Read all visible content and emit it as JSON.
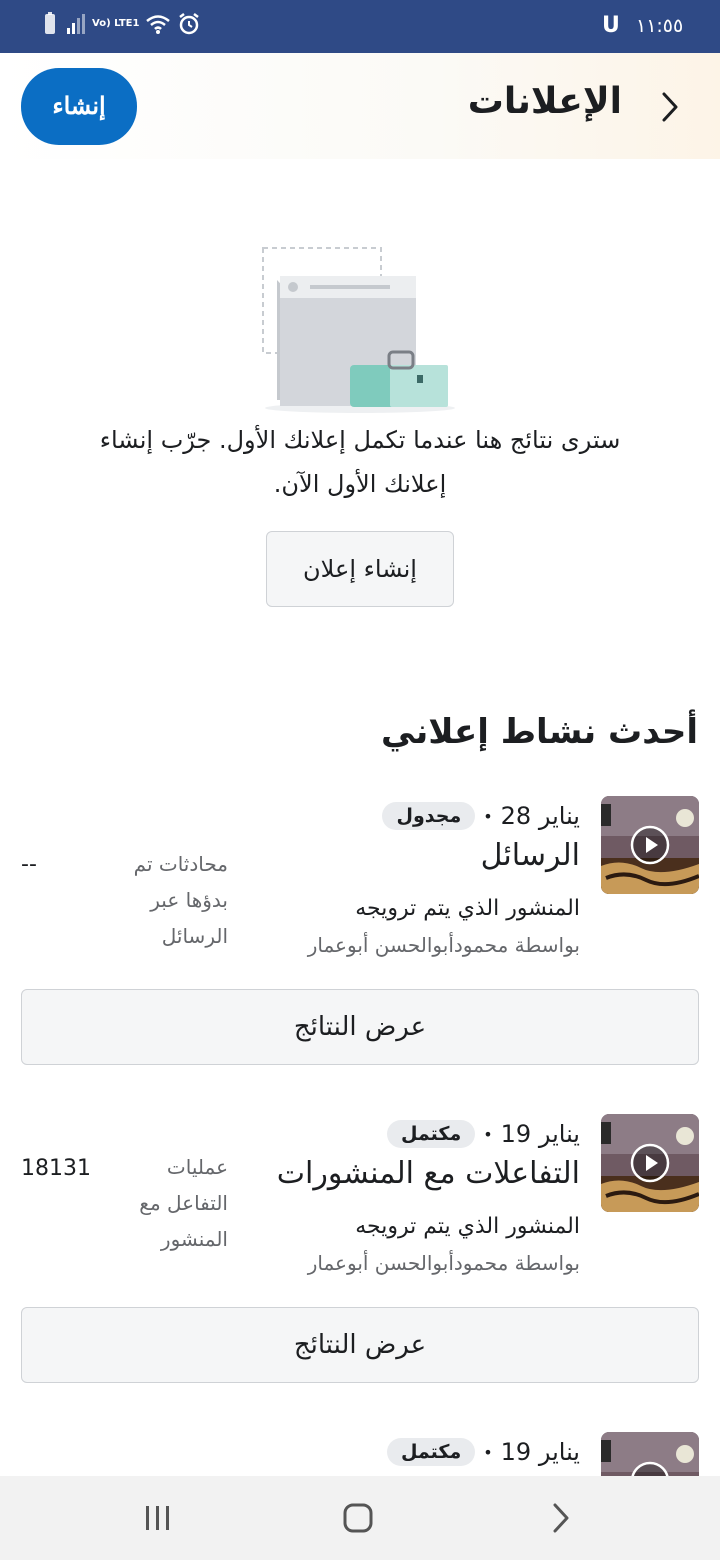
{
  "status_bar": {
    "time": "١١:٥٥",
    "carrier_mark": "U",
    "network_label": "Vo) LTE1",
    "icons": [
      "battery-icon",
      "signal-icon",
      "wifi-icon",
      "alarm-icon"
    ]
  },
  "header": {
    "title": "الإعلانات",
    "create_label": "إنشاء",
    "back_icon": "chevron-icon",
    "accent_color": "#0b6ec4"
  },
  "empty_state": {
    "line1": "سترى نتائج هنا عندما تكمل إعلانك الأول. جرّب إنشاء",
    "line2": "إعلانك الأول الآن.",
    "button_label": "إنشاء إعلان"
  },
  "recent_activity": {
    "title": "أحدث نشاط إعلاني",
    "cards": [
      {
        "date": "يناير 28",
        "status": "مجدول",
        "title": "الرسائل",
        "subtitle": "المنشور الذي يتم ترويجه",
        "by": "بواسطة محمودأبوالحسن أبوعمار",
        "metric_label": "محادثات تم بدؤها عبر الرسائل",
        "metric_value": "--",
        "button_label": "عرض النتائج"
      },
      {
        "date": "يناير 19",
        "status": "مكتمل",
        "title": "التفاعلات مع المنشورات",
        "subtitle": "المنشور الذي يتم ترويجه",
        "by": "بواسطة محمودأبوالحسن أبوعمار",
        "metric_label": "عمليات التفاعل مع المنشور",
        "metric_value": "18131",
        "button_label": "عرض النتائج"
      },
      {
        "date": "يناير 19",
        "status": "مكتمل"
      }
    ]
  },
  "nav_bar": {
    "icons": [
      "recent-apps-icon",
      "home-icon",
      "back-icon"
    ]
  }
}
